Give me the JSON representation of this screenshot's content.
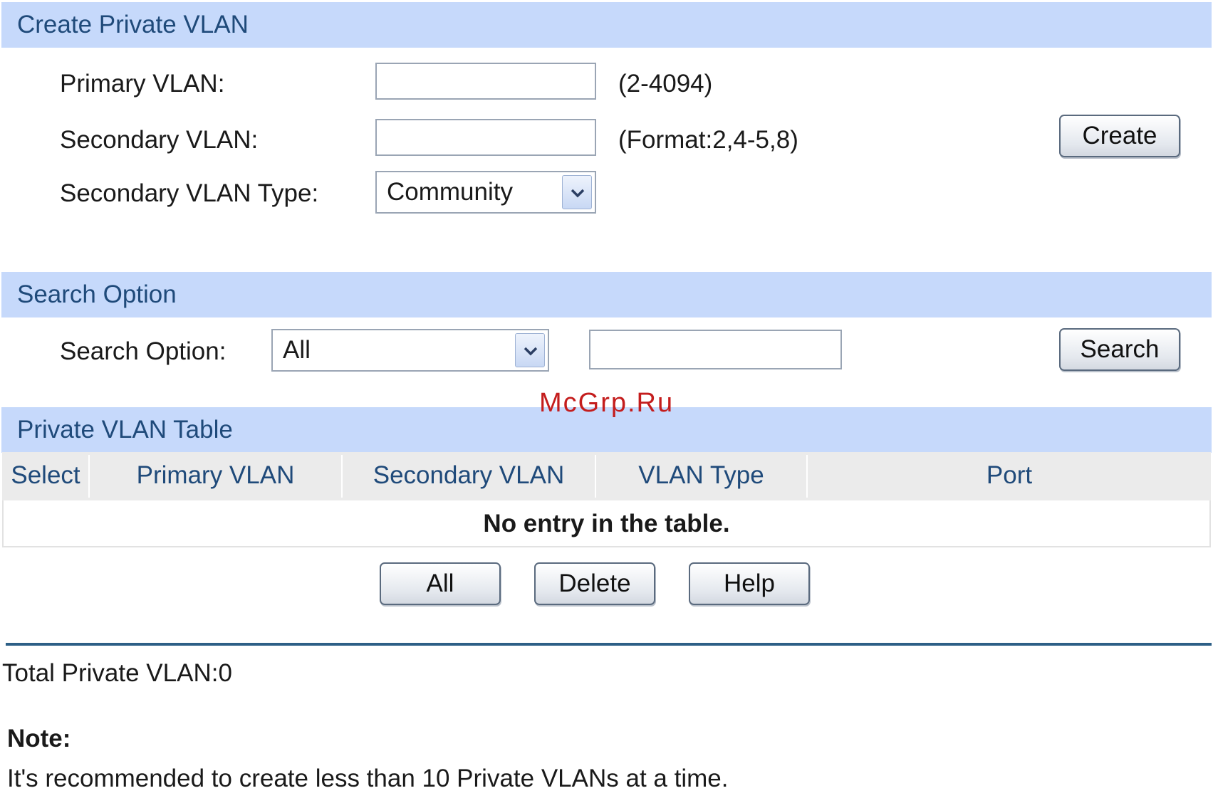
{
  "create_section": {
    "title": "Create Private VLAN",
    "primary_vlan_label": "Primary VLAN:",
    "primary_vlan_value": "",
    "primary_vlan_hint": "(2-4094)",
    "secondary_vlan_label": "Secondary VLAN:",
    "secondary_vlan_value": "",
    "secondary_vlan_hint": "(Format:2,4-5,8)",
    "secondary_type_label": "Secondary VLAN Type:",
    "secondary_type_value": "Community",
    "create_button": "Create"
  },
  "search_section": {
    "title": "Search Option",
    "search_label": "Search Option:",
    "search_option_value": "All",
    "search_text_value": "",
    "search_button": "Search"
  },
  "watermark": "McGrp.Ru",
  "table_section": {
    "title": "Private VLAN Table",
    "columns": [
      "Select",
      "Primary VLAN",
      "Secondary VLAN",
      "VLAN Type",
      "Port"
    ],
    "empty_message": "No entry in the table.",
    "buttons": {
      "all": "All",
      "delete": "Delete",
      "help": "Help"
    }
  },
  "footer": {
    "total_text": "Total Private VLAN:0",
    "note_title": "Note:",
    "note_text": "It's recommended to create less than 10 Private VLANs at a time."
  },
  "colors": {
    "section_header_bg": "#c6d9fb",
    "section_header_text": "#1f4a7a",
    "divider": "#2d5f86",
    "watermark": "#c41d1d"
  },
  "icons": {
    "dropdown": "chevron-down-icon"
  }
}
